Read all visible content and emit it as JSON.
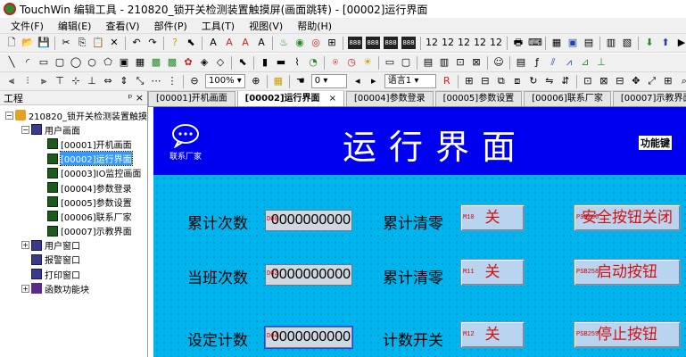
{
  "window": {
    "title": "TouchWin 编辑工具 - 210820_锁开关检测装置触摸屏(画面跳转) - [00002]运行界面"
  },
  "menu": [
    "文件(F)",
    "编辑(E)",
    "查看(V)",
    "部件(P)",
    "工具(T)",
    "视图(V)",
    "帮助(H)"
  ],
  "toolbar": {
    "zoom": "100%",
    "frame": "0",
    "language": "语言1"
  },
  "project_panel": {
    "title": "工程",
    "pin": "ᵖ ×",
    "tree": [
      {
        "label": "210820_锁开关检测装置触摸",
        "level": 0,
        "expander": "−",
        "icon": "home"
      },
      {
        "label": "用户画面",
        "level": 1,
        "expander": "−",
        "icon": "screen"
      },
      {
        "label": "[00001]开机画面",
        "level": 2,
        "expander": "",
        "icon": "pic"
      },
      {
        "label": "[00002]运行界面",
        "level": 2,
        "expander": "",
        "icon": "pic",
        "selected": true
      },
      {
        "label": "[00003]IO监控画面",
        "level": 2,
        "expander": "",
        "icon": "pic"
      },
      {
        "label": "[00004]参数登录",
        "level": 2,
        "expander": "",
        "icon": "pic"
      },
      {
        "label": "[00005]参数设置",
        "level": 2,
        "expander": "",
        "icon": "pic"
      },
      {
        "label": "[00006]联系厂家",
        "level": 2,
        "expander": "",
        "icon": "pic"
      },
      {
        "label": "[00007]示教界面",
        "level": 2,
        "expander": "",
        "icon": "pic"
      },
      {
        "label": "用户窗口",
        "level": 1,
        "expander": "+",
        "icon": "screen"
      },
      {
        "label": "报警窗口",
        "level": 1,
        "expander": "",
        "icon": "screen"
      },
      {
        "label": "打印窗口",
        "level": 1,
        "expander": "",
        "icon": "screen"
      },
      {
        "label": "函数功能块",
        "level": 1,
        "expander": "+",
        "icon": "fn"
      }
    ]
  },
  "tabs": [
    {
      "label": "[00001]开机画面",
      "active": false
    },
    {
      "label": "[00002]运行界面",
      "active": true,
      "close": "×"
    },
    {
      "label": "[00004]参数登录",
      "active": false
    },
    {
      "label": "[00005]参数设置",
      "active": false
    },
    {
      "label": "[00006]联系厂家",
      "active": false
    },
    {
      "label": "[00007]示教界面",
      "active": false
    }
  ],
  "screen": {
    "brand_label": "联系厂家",
    "title": "运行界面",
    "function_key": "功能键",
    "rows": [
      {
        "label": "累计次数",
        "num_tag": "D00",
        "value": "0000000000",
        "action_label": "累计清零",
        "btn_tag": "M10",
        "btn_text": "关",
        "psb_tag": "PSB256",
        "psb_text": "安全按钮关闭"
      },
      {
        "label": "当班次数",
        "num_tag": "D02",
        "value": "0000000000",
        "action_label": "累计清零",
        "btn_tag": "M11",
        "btn_text": "关",
        "psb_tag": "PSB258",
        "psb_text": "启动按钮"
      },
      {
        "label": "设定计数",
        "num_tag": "D04",
        "value": "0000000000",
        "action_label": "计数开关",
        "btn_tag": "M12",
        "btn_text": "关",
        "psb_tag": "PSB259",
        "psb_text": "停止按钮"
      }
    ]
  },
  "colors": {
    "header_blue": "#0000f0",
    "body_teal": "#00b4ee",
    "button_face": "#b8d4ee",
    "button_text": "#d81010"
  }
}
